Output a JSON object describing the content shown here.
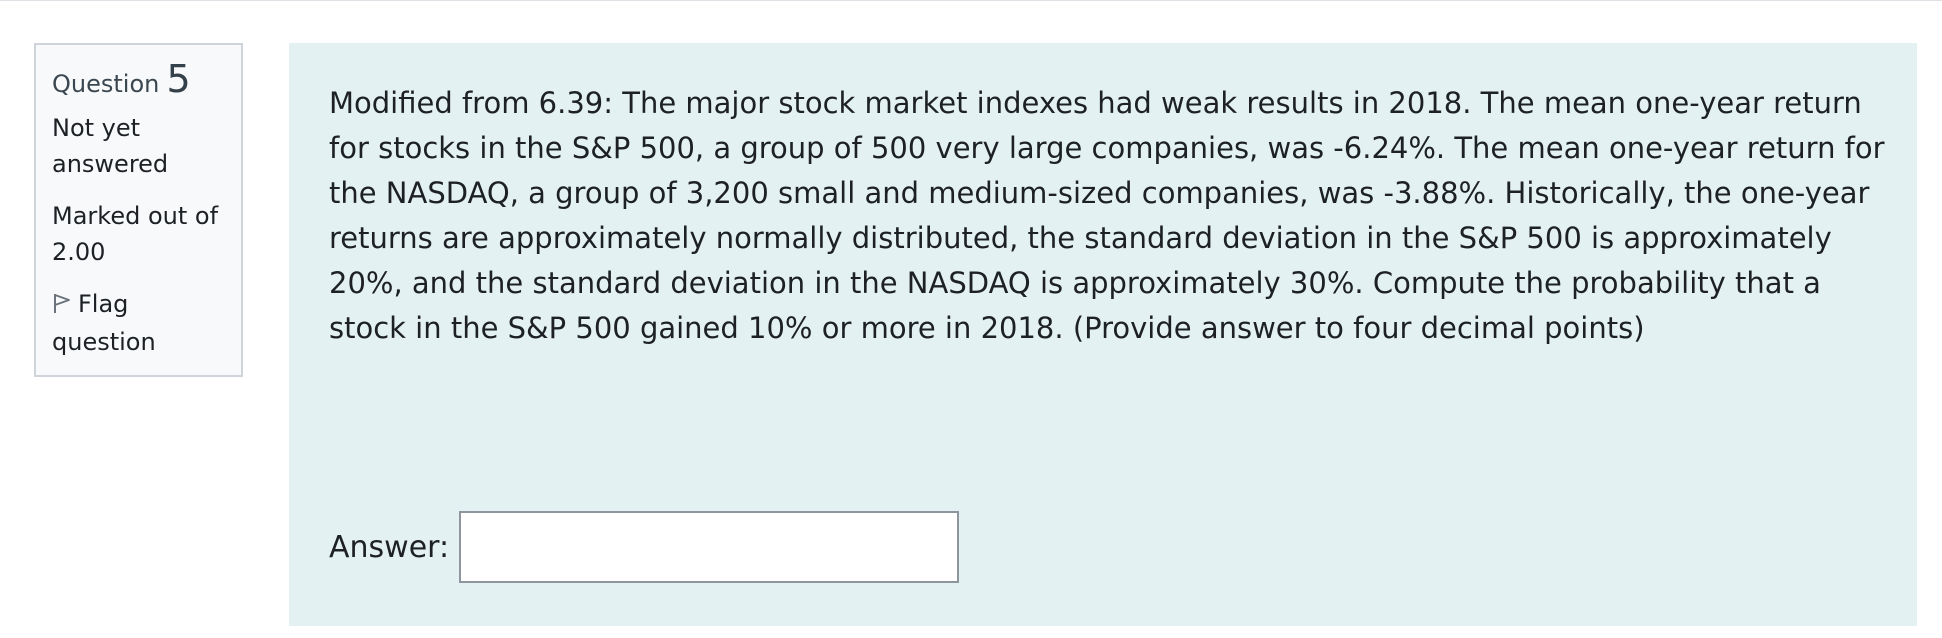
{
  "question": {
    "label": "Question",
    "number": "5",
    "state_line1": "Not yet",
    "state_line2": "answered",
    "marked_line1": "Marked out of",
    "marked_line2": "2.00",
    "flag_line1": "Flag",
    "flag_line2": "question",
    "text": "Modified from 6.39: The major stock market indexes had weak results in 2018.  The mean one-year return for stocks in the S&P 500, a group of 500 very large companies, was -6.24%.  The mean one-year return for the NASDAQ, a group of 3,200 small and medium-sized companies, was -3.88%.  Historically, the one-year returns are approximately normally distributed, the standard deviation in the S&P 500 is approximately 20%, and the standard deviation in the NASDAQ is approximately 30%.  Compute the probability that a stock in the S&P 500 gained 10% or more in 2018.  (Provide answer to four decimal points)"
  },
  "answer": {
    "label": "Answer:",
    "value": ""
  },
  "icons": {
    "flag": "flag-icon"
  },
  "colors": {
    "content_background": "#e3f1f2",
    "info_background": "#f8f9fa",
    "info_border": "#cfd4da"
  }
}
